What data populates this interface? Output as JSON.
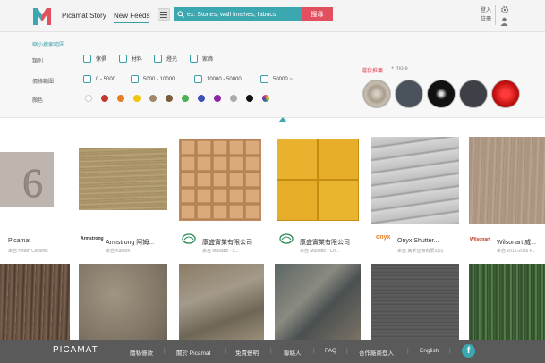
{
  "header": {
    "nav_story": "Picamat Story",
    "nav_feeds": "New Feeds",
    "search_placeholder": "ex: Stones, wall finishes, fabrics",
    "search_button": "搜尋",
    "login": "登入",
    "register": "註冊"
  },
  "filter": {
    "title": "縮小搜索範圍",
    "category_label": "類別",
    "categories": [
      "傢俱",
      "材料",
      "燈光",
      "家飾"
    ],
    "price_label": "價格範圍",
    "prices": [
      "0 - 5000",
      "5000 - 10000",
      "10000 - 50000",
      "50000 ~"
    ],
    "color_label": "顏色",
    "colors": [
      "#ffffff",
      "#c0392b",
      "#e67e22",
      "#f1c40f",
      "#a0896b",
      "#7a5c3a",
      "#4caf50",
      "#3f51b5",
      "#8e24aa",
      "#aaaaaa",
      "#111111",
      "multi"
    ],
    "recommend_title": "選我推薦",
    "recommend_more": "+ more"
  },
  "cards": [
    {
      "title": "Picamat",
      "sub": "來自 Heath Ceramic",
      "brand": ""
    },
    {
      "title": "Armstrong 阿姆...",
      "sub": "來自 Karson",
      "brand": "Armstrong"
    },
    {
      "title": "康盛實業有限公司",
      "sub": "來自 Musatto - 5...",
      "brand": ""
    },
    {
      "title": "康盛實業有限公司",
      "sub": "來自 Musatto - Ch...",
      "brand": ""
    },
    {
      "title": "Onyx Shutter...",
      "sub": "來自 廣禾亞洲有限公司",
      "brand": "onyx"
    },
    {
      "title": "Wilsonart 威...",
      "sub": "來自 2015-2016 F...",
      "brand": "Wilsonart"
    }
  ],
  "footer": {
    "logo": "PICAMAT",
    "links": [
      "隱私條款",
      "關於 Picamat",
      "免責聲明",
      "聯絡人",
      "FAQ",
      "合作廠商登入",
      "English"
    ],
    "social": "f"
  }
}
